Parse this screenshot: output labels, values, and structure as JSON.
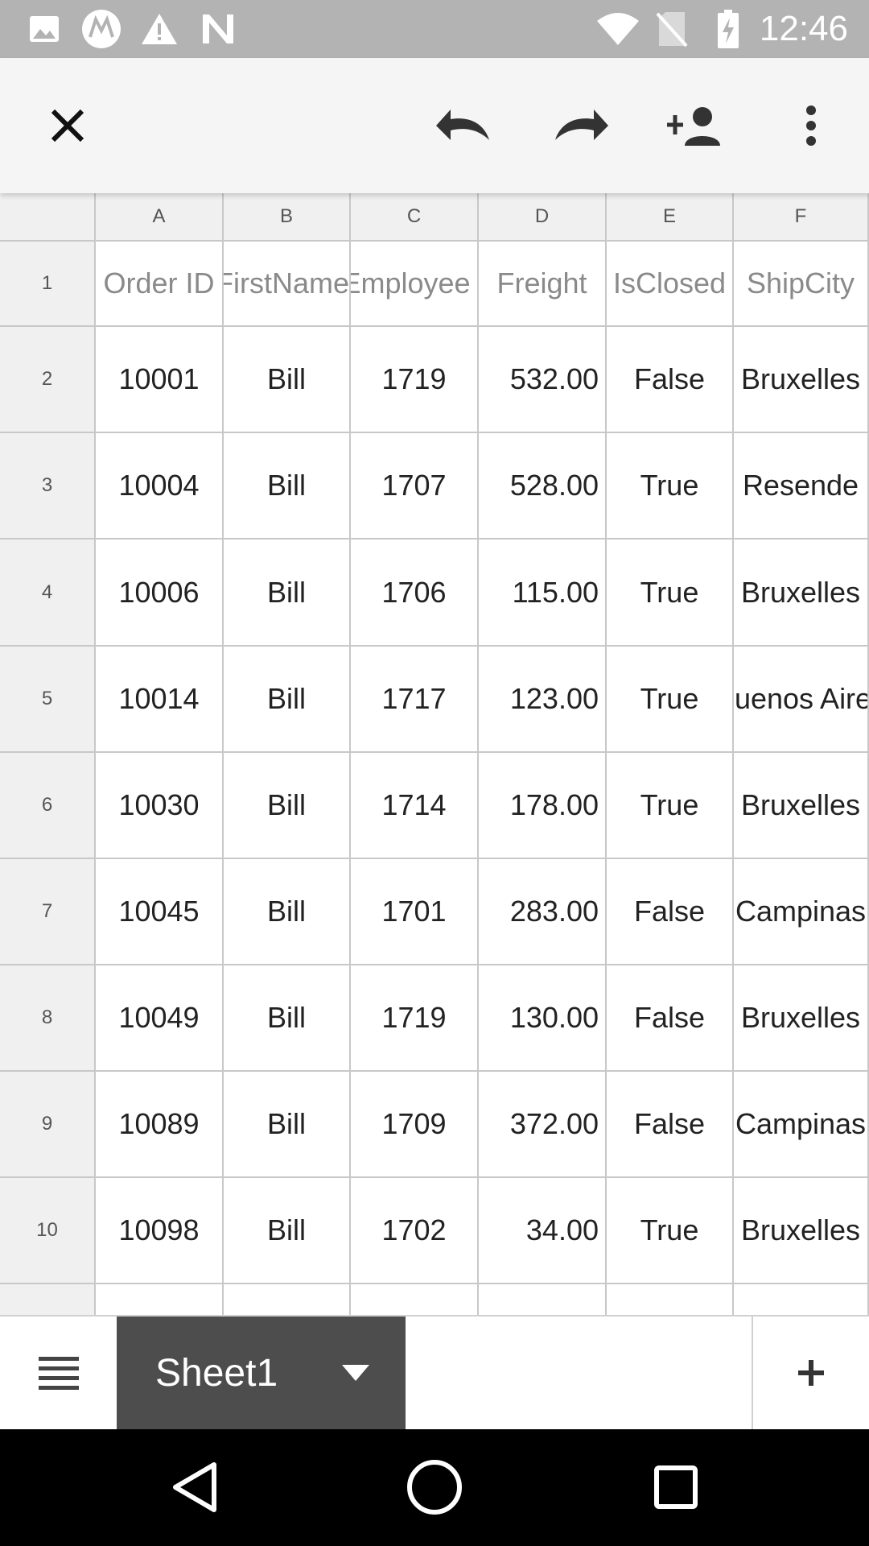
{
  "status_bar": {
    "time": "12:46",
    "icons": [
      "gallery-icon",
      "motorola-icon",
      "warning-icon",
      "n-icon",
      "wifi-icon",
      "no-sim-icon",
      "battery-charging-icon"
    ]
  },
  "toolbar": {
    "icons": [
      "close-icon",
      "undo-icon",
      "redo-icon",
      "add-person-icon",
      "more-vert-icon"
    ]
  },
  "sheet": {
    "columns": [
      "A",
      "B",
      "C",
      "D",
      "E",
      "F"
    ],
    "rows": [
      {
        "num": "1",
        "cells": [
          "Order ID",
          "FirstName",
          "Employee I",
          "Freight",
          "IsClosed",
          "ShipCity"
        ]
      },
      {
        "num": "2",
        "cells": [
          "10001",
          "Bill",
          "1719",
          "532.00",
          "False",
          "Bruxelles"
        ]
      },
      {
        "num": "3",
        "cells": [
          "10004",
          "Bill",
          "1707",
          "528.00",
          "True",
          "Resende"
        ]
      },
      {
        "num": "4",
        "cells": [
          "10006",
          "Bill",
          "1706",
          "115.00",
          "True",
          "Bruxelles"
        ]
      },
      {
        "num": "5",
        "cells": [
          "10014",
          "Bill",
          "1717",
          "123.00",
          "True",
          "Buenos Aires"
        ]
      },
      {
        "num": "6",
        "cells": [
          "10030",
          "Bill",
          "1714",
          "178.00",
          "True",
          "Bruxelles"
        ]
      },
      {
        "num": "7",
        "cells": [
          "10045",
          "Bill",
          "1701",
          "283.00",
          "False",
          "Campinas"
        ]
      },
      {
        "num": "8",
        "cells": [
          "10049",
          "Bill",
          "1719",
          "130.00",
          "False",
          "Bruxelles"
        ]
      },
      {
        "num": "9",
        "cells": [
          "10089",
          "Bill",
          "1709",
          "372.00",
          "False",
          "Campinas"
        ]
      },
      {
        "num": "10",
        "cells": [
          "10098",
          "Bill",
          "1702",
          "34.00",
          "True",
          "Bruxelles"
        ]
      }
    ]
  },
  "tab_bar": {
    "active_sheet": "Sheet1",
    "icons": [
      "sheet-list-icon",
      "dropdown-arrow-icon",
      "add-sheet-icon"
    ]
  },
  "nav_bar": {
    "icons": [
      "back-icon",
      "home-icon",
      "recents-icon"
    ]
  }
}
